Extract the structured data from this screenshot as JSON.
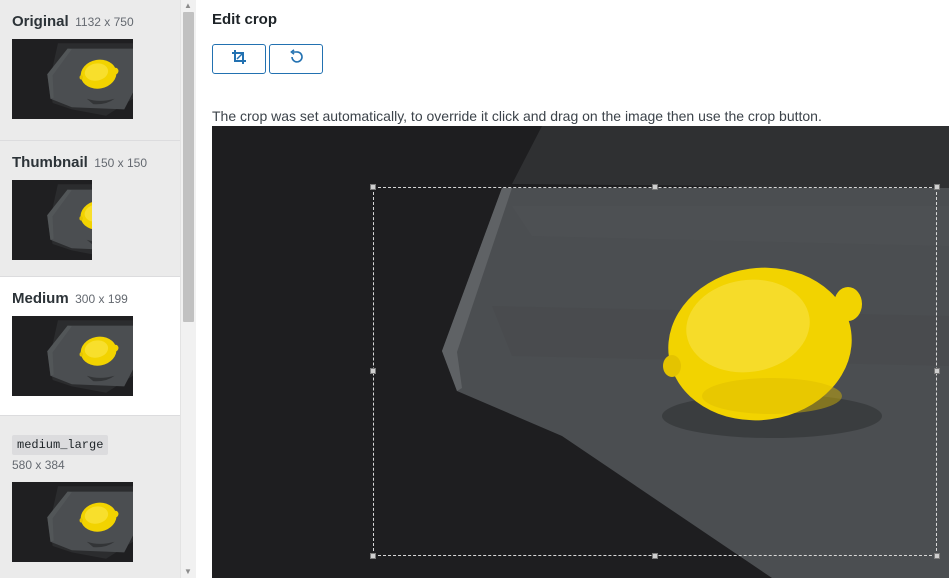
{
  "sidebar": {
    "sizes": [
      {
        "name": "Original",
        "dims": "1132 x 750",
        "selected": false
      },
      {
        "name": "Thumbnail",
        "dims": "150 x 150",
        "selected": false
      },
      {
        "name": "Medium",
        "dims": "300 x 199",
        "selected": true
      },
      {
        "name": "medium_large",
        "dims": "580 x 384",
        "selected": false
      }
    ]
  },
  "main": {
    "title": "Edit crop",
    "crop_button_icon": "crop-icon",
    "undo_button_icon": "undo-icon",
    "instructions": "The crop was set automatically, to override it click and drag on the image then use the crop button."
  },
  "colors": {
    "accent": "#2271b1",
    "lemon": "#f5d90a",
    "slate": "#4a4d50",
    "background": "#1c1c1c"
  }
}
